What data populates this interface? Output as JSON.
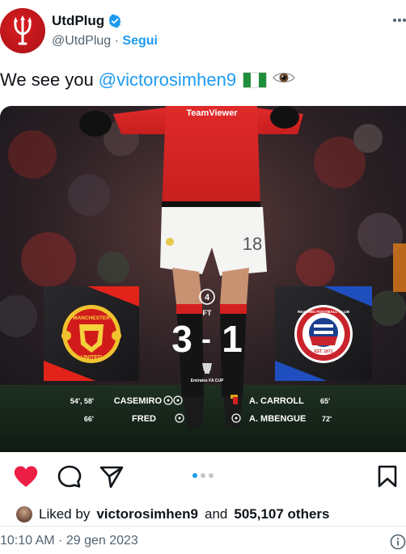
{
  "author": {
    "name": "UtdPlug",
    "handle": "@UtdPlug",
    "separator": " · ",
    "follow_label": "Segui"
  },
  "tweet": {
    "text_prefix": "We see you",
    "mention": "@victorosimhen9",
    "emoji_flag": "nigeria-flag",
    "emoji_eye": "👁️"
  },
  "media": {
    "jersey_sponsor": "TeamViewer",
    "shirt_number": "18",
    "round": "4",
    "status": "FT",
    "home_score": "3",
    "score_dash": "-",
    "away_score": "1",
    "competition": "Emirates FA CUP",
    "home_crest": {
      "top_text": "MANCHESTER",
      "bottom_text": "UNITED"
    },
    "away_crest": {
      "ring_text": "READING FOOTBALL CLUB",
      "est_text": "EST. 1871"
    },
    "home_scorers": [
      {
        "minutes": "54', 58'",
        "name": "CASEMIRO",
        "icons": 2
      },
      {
        "minutes": "66'",
        "name": "FRED",
        "icons": 1
      }
    ],
    "away_events": [
      {
        "name": "A. CARROLL",
        "minute": "65'",
        "icon": "red-card"
      },
      {
        "name": "A. MBENGUE",
        "minute": "72'",
        "icon": "own-goal-ball"
      }
    ],
    "colors": {
      "home_accent": "#e2231a",
      "away_accent": "#1f4fbf"
    }
  },
  "instagram": {
    "carousel_dots": 3,
    "active_dot": 0,
    "liked_by_prefix": "Liked by",
    "liked_by_user": "victorosimhen9",
    "liked_by_and": "and",
    "liked_by_count": "505,107 others"
  },
  "timestamp": "10:10 AM · 29 gen 2023",
  "colors": {
    "link": "#1d9bf0",
    "heart": "#ed1e45",
    "muted": "#536471"
  }
}
